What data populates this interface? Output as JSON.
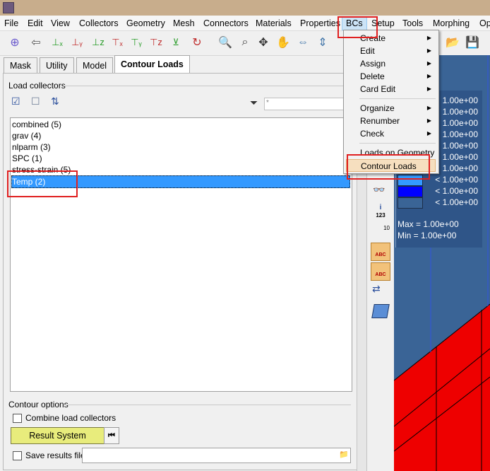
{
  "menubar": {
    "items": [
      "File",
      "Edit",
      "View",
      "Collectors",
      "Geometry",
      "Mesh",
      "Connectors",
      "Materials",
      "Properties",
      "BCs",
      "Setup",
      "Tools",
      "Morphing",
      "Op"
    ]
  },
  "tabs": [
    "Mask",
    "Utility",
    "Model",
    "Contour Loads"
  ],
  "active_tab": "Contour Loads",
  "load_collectors": {
    "label": "Load collectors",
    "filter_value": "*",
    "items": [
      "combined (5)",
      "grav (4)",
      "nlparm (3)",
      "SPC (1)",
      "stress-strain (5)",
      "Temp (2)"
    ],
    "selected": "Temp (2)"
  },
  "contour_options": {
    "label": "Contour options",
    "combine_label": "Combine load collectors",
    "result_system_label": "Result System",
    "save_results_label": "Save results file"
  },
  "bcs_menu": {
    "items": [
      "Create",
      "Edit",
      "Assign",
      "Delete",
      "Card Edit",
      "Organize",
      "Renumber",
      "Check",
      "Loads on Geometry",
      "Contour Loads"
    ],
    "submenu_items": [
      "Create",
      "Edit",
      "Assign",
      "Delete",
      "Card Edit",
      "Organize",
      "Renumber",
      "Check"
    ],
    "highlighted": "Contour Loads"
  },
  "legend": {
    "values": [
      "1.00e+00",
      "1.00e+00",
      "1.00e+00",
      "1.00e+00",
      "1.00e+00",
      "1.00e+00",
      "1.00e+00",
      "< 1.00e+00",
      "< 1.00e+00",
      "< 1.00e+00"
    ],
    "max_label": "Max = 1.00e+00",
    "min_label": "Min = 1.00e+00",
    "colors": [
      "#ff0000",
      "#ff0000",
      "#ff0000",
      "#ff0000",
      "#ff0000",
      "#ff0000",
      "#ff0000",
      "#3399ff",
      "#0000ff",
      "#3a6496"
    ]
  },
  "sidebar": {
    "info_label": "123",
    "abc_label": "ABC",
    "scale_label": "10"
  },
  "colors": {
    "highlight": "#e02020",
    "selection": "#3399ff",
    "viewport": "#3a6496",
    "mesh": "#ee0000"
  }
}
